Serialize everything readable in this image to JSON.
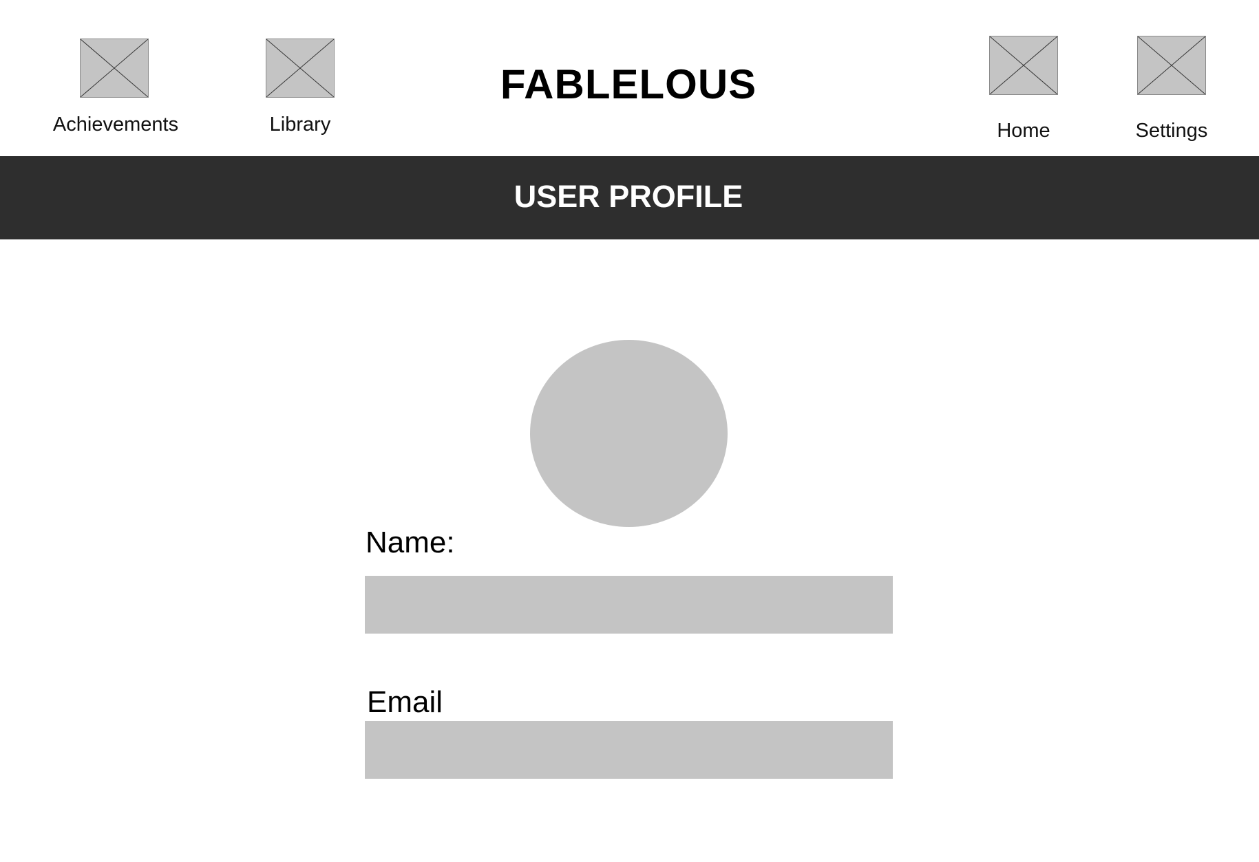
{
  "header": {
    "app_title": "FABLELOUS",
    "nav": {
      "achievements": {
        "label": "Achievements",
        "icon": "image-placeholder-icon"
      },
      "library": {
        "label": "Library",
        "icon": "image-placeholder-icon"
      },
      "home": {
        "label": "Home",
        "icon": "image-placeholder-icon"
      },
      "settings": {
        "label": "Settings",
        "icon": "image-placeholder-icon"
      }
    }
  },
  "banner": {
    "title": "USER PROFILE",
    "color": "#2e2e2e"
  },
  "profile": {
    "avatar_color": "#c4c4c4",
    "name_label": "Name:",
    "name_value": "",
    "email_label": "Email",
    "email_value": ""
  }
}
